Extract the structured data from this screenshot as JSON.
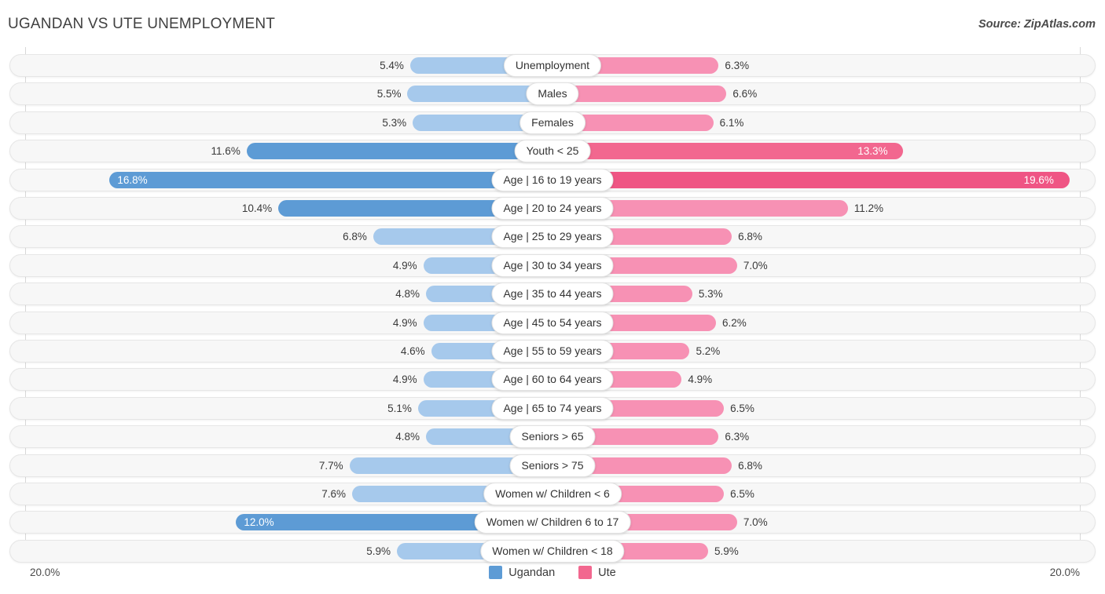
{
  "title": "UGANDAN VS UTE UNEMPLOYMENT",
  "source": "Source: ZipAtlas.com",
  "axis": {
    "left_tick": "20.0%",
    "right_tick": "20.0%",
    "max": 20.0
  },
  "legend": [
    {
      "name": "legend-ugandan",
      "label": "Ugandan",
      "color": "#5d9bd5"
    },
    {
      "name": "legend-ute",
      "label": "Ute",
      "color": "#f2678f"
    }
  ],
  "colors": {
    "left_light": "#a6c9ec",
    "left_dark": "#5d9bd5",
    "right_light": "#f791b4",
    "right_dark": "#f2678f",
    "right_darkest": "#ef5584"
  },
  "chart_data": {
    "type": "bar",
    "title": "UGANDAN VS UTE UNEMPLOYMENT",
    "subtitle": "Source: ZipAtlas.com",
    "orientation": "horizontal-diverging",
    "xlabel": "",
    "ylabel": "",
    "xlim": [
      -20.0,
      20.0
    ],
    "axis_ticks": [
      "20.0%",
      "20.0%"
    ],
    "grid": false,
    "legend_position": "bottom-center",
    "categories": [
      "Unemployment",
      "Males",
      "Females",
      "Youth < 25",
      "Age | 16 to 19 years",
      "Age | 20 to 24 years",
      "Age | 25 to 29 years",
      "Age | 30 to 34 years",
      "Age | 35 to 44 years",
      "Age | 45 to 54 years",
      "Age | 55 to 59 years",
      "Age | 60 to 64 years",
      "Age | 65 to 74 years",
      "Seniors > 65",
      "Seniors > 75",
      "Women w/ Children < 6",
      "Women w/ Children 6 to 17",
      "Women w/ Children < 18"
    ],
    "series": [
      {
        "name": "Ugandan",
        "color": "#5d9bd5",
        "values": [
          5.4,
          5.5,
          5.3,
          11.6,
          16.8,
          10.4,
          6.8,
          4.9,
          4.8,
          4.9,
          4.6,
          4.9,
          5.1,
          4.8,
          7.7,
          7.6,
          12.0,
          5.9
        ],
        "labels": [
          "5.4%",
          "5.5%",
          "5.3%",
          "11.6%",
          "16.8%",
          "10.4%",
          "6.8%",
          "4.9%",
          "4.8%",
          "4.9%",
          "4.6%",
          "4.9%",
          "5.1%",
          "4.8%",
          "7.7%",
          "7.6%",
          "12.0%",
          "5.9%"
        ]
      },
      {
        "name": "Ute",
        "color": "#f2678f",
        "values": [
          6.3,
          6.6,
          6.1,
          13.3,
          19.6,
          11.2,
          6.8,
          7.0,
          5.3,
          6.2,
          5.2,
          4.9,
          6.5,
          6.3,
          6.8,
          6.5,
          7.0,
          5.9
        ],
        "labels": [
          "6.3%",
          "6.6%",
          "6.1%",
          "13.3%",
          "19.6%",
          "11.2%",
          "6.8%",
          "7.0%",
          "5.3%",
          "6.2%",
          "5.2%",
          "4.9%",
          "6.5%",
          "6.3%",
          "6.8%",
          "6.5%",
          "7.0%",
          "5.9%"
        ]
      }
    ]
  },
  "rows": [
    {
      "category": "Unemployment",
      "left": "5.4%",
      "right": "6.3%",
      "left_val": 5.4,
      "right_val": 6.3,
      "left_inside": false,
      "right_inside": false,
      "left_tone": "light",
      "right_tone": "light"
    },
    {
      "category": "Males",
      "left": "5.5%",
      "right": "6.6%",
      "left_val": 5.5,
      "right_val": 6.6,
      "left_inside": false,
      "right_inside": false,
      "left_tone": "light",
      "right_tone": "light"
    },
    {
      "category": "Females",
      "left": "5.3%",
      "right": "6.1%",
      "left_val": 5.3,
      "right_val": 6.1,
      "left_inside": false,
      "right_inside": false,
      "left_tone": "light",
      "right_tone": "light"
    },
    {
      "category": "Youth < 25",
      "left": "11.6%",
      "right": "13.3%",
      "left_val": 11.6,
      "right_val": 13.3,
      "left_inside": false,
      "right_inside": true,
      "left_tone": "dark",
      "right_tone": "dark"
    },
    {
      "category": "Age | 16 to 19 years",
      "left": "16.8%",
      "right": "19.6%",
      "left_val": 16.8,
      "right_val": 19.6,
      "left_inside": true,
      "right_inside": true,
      "left_tone": "dark",
      "right_tone": "darkest"
    },
    {
      "category": "Age | 20 to 24 years",
      "left": "10.4%",
      "right": "11.2%",
      "left_val": 10.4,
      "right_val": 11.2,
      "left_inside": false,
      "right_inside": false,
      "left_tone": "dark",
      "right_tone": "light"
    },
    {
      "category": "Age | 25 to 29 years",
      "left": "6.8%",
      "right": "6.8%",
      "left_val": 6.8,
      "right_val": 6.8,
      "left_inside": false,
      "right_inside": false,
      "left_tone": "light",
      "right_tone": "light"
    },
    {
      "category": "Age | 30 to 34 years",
      "left": "4.9%",
      "right": "7.0%",
      "left_val": 4.9,
      "right_val": 7.0,
      "left_inside": false,
      "right_inside": false,
      "left_tone": "light",
      "right_tone": "light"
    },
    {
      "category": "Age | 35 to 44 years",
      "left": "4.8%",
      "right": "5.3%",
      "left_val": 4.8,
      "right_val": 5.3,
      "left_inside": false,
      "right_inside": false,
      "left_tone": "light",
      "right_tone": "light"
    },
    {
      "category": "Age | 45 to 54 years",
      "left": "4.9%",
      "right": "6.2%",
      "left_val": 4.9,
      "right_val": 6.2,
      "left_inside": false,
      "right_inside": false,
      "left_tone": "light",
      "right_tone": "light"
    },
    {
      "category": "Age | 55 to 59 years",
      "left": "4.6%",
      "right": "5.2%",
      "left_val": 4.6,
      "right_val": 5.2,
      "left_inside": false,
      "right_inside": false,
      "left_tone": "light",
      "right_tone": "light"
    },
    {
      "category": "Age | 60 to 64 years",
      "left": "4.9%",
      "right": "4.9%",
      "left_val": 4.9,
      "right_val": 4.9,
      "left_inside": false,
      "right_inside": false,
      "left_tone": "light",
      "right_tone": "light"
    },
    {
      "category": "Age | 65 to 74 years",
      "left": "5.1%",
      "right": "6.5%",
      "left_val": 5.1,
      "right_val": 6.5,
      "left_inside": false,
      "right_inside": false,
      "left_tone": "light",
      "right_tone": "light"
    },
    {
      "category": "Seniors > 65",
      "left": "4.8%",
      "right": "6.3%",
      "left_val": 4.8,
      "right_val": 6.3,
      "left_inside": false,
      "right_inside": false,
      "left_tone": "light",
      "right_tone": "light"
    },
    {
      "category": "Seniors > 75",
      "left": "7.7%",
      "right": "6.8%",
      "left_val": 7.7,
      "right_val": 6.8,
      "left_inside": false,
      "right_inside": false,
      "left_tone": "light",
      "right_tone": "light"
    },
    {
      "category": "Women w/ Children < 6",
      "left": "7.6%",
      "right": "6.5%",
      "left_val": 7.6,
      "right_val": 6.5,
      "left_inside": false,
      "right_inside": false,
      "left_tone": "light",
      "right_tone": "light"
    },
    {
      "category": "Women w/ Children 6 to 17",
      "left": "12.0%",
      "right": "7.0%",
      "left_val": 12.0,
      "right_val": 7.0,
      "left_inside": true,
      "right_inside": false,
      "left_tone": "dark",
      "right_tone": "light"
    },
    {
      "category": "Women w/ Children < 18",
      "left": "5.9%",
      "right": "5.9%",
      "left_val": 5.9,
      "right_val": 5.9,
      "left_inside": false,
      "right_inside": false,
      "left_tone": "light",
      "right_tone": "light"
    }
  ]
}
